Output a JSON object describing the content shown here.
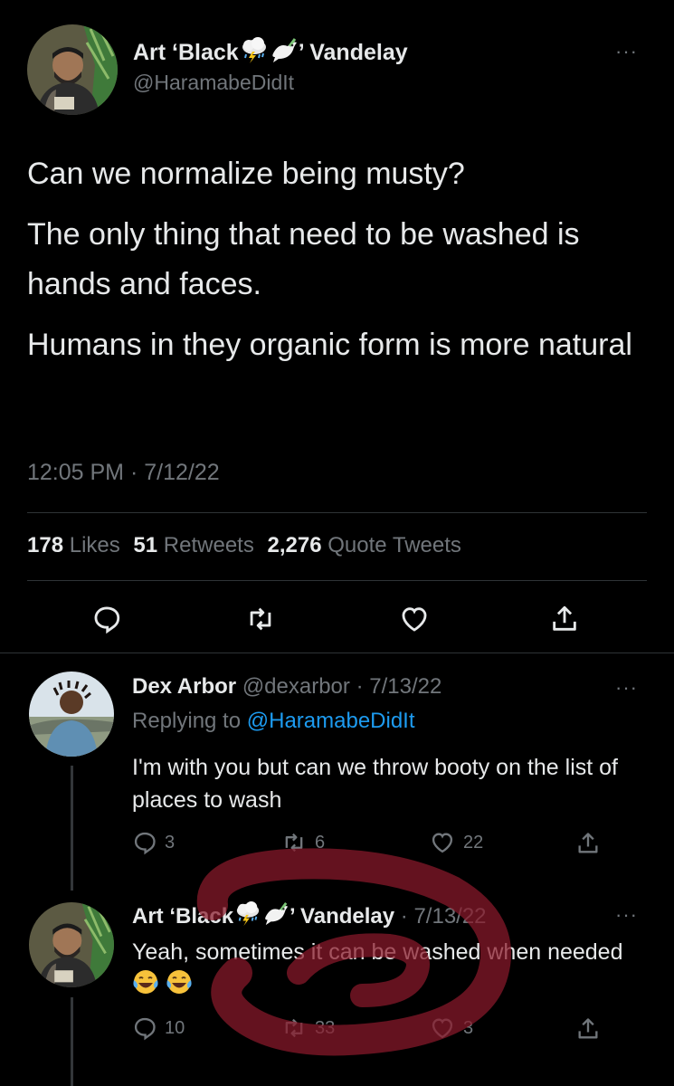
{
  "main_tweet": {
    "author_name_prefix": "Art ‘Black",
    "author_name_suffix": "’ Vandelay",
    "author_handle": "@HaramabeDidIt",
    "text_lines": [
      "Can we normalize being musty?",
      "The only thing that need to be washed is hands and faces.",
      "Humans in they organic form is more natural"
    ],
    "timestamp": "12:05 PM · 7/12/22",
    "stats": {
      "likes_count": "178",
      "likes_label": "Likes",
      "retweets_count": "51",
      "retweets_label": "Retweets",
      "quotes_count": "2,276",
      "quotes_label": "Quote Tweets"
    },
    "more_icon": "more-dots-icon"
  },
  "replies": [
    {
      "author_name": "Dex Arbor",
      "author_handle": "@dexarbor",
      "date": "· 7/13/22",
      "replying_to_label": "Replying to",
      "replying_to_handle": "@HaramabeDidIt",
      "text": "I'm with you but can we throw booty on the list of places to wash",
      "reply_count": "3",
      "retweet_count": "6",
      "like_count": "22"
    },
    {
      "author_name_prefix": "Art ‘Black",
      "author_name_suffix": "’ Vandelay",
      "date": "· 7/13/22",
      "text": "Yeah, sometimes it can be washed when needed",
      "reply_count": "10",
      "retweet_count": "33",
      "like_count": "3"
    }
  ],
  "colors": {
    "background": "#000000",
    "text": "#e7e9ea",
    "secondary": "#71767b",
    "link": "#1d9bf0",
    "divider": "#2f3336",
    "marker_overlay": "#8b1a2b"
  }
}
